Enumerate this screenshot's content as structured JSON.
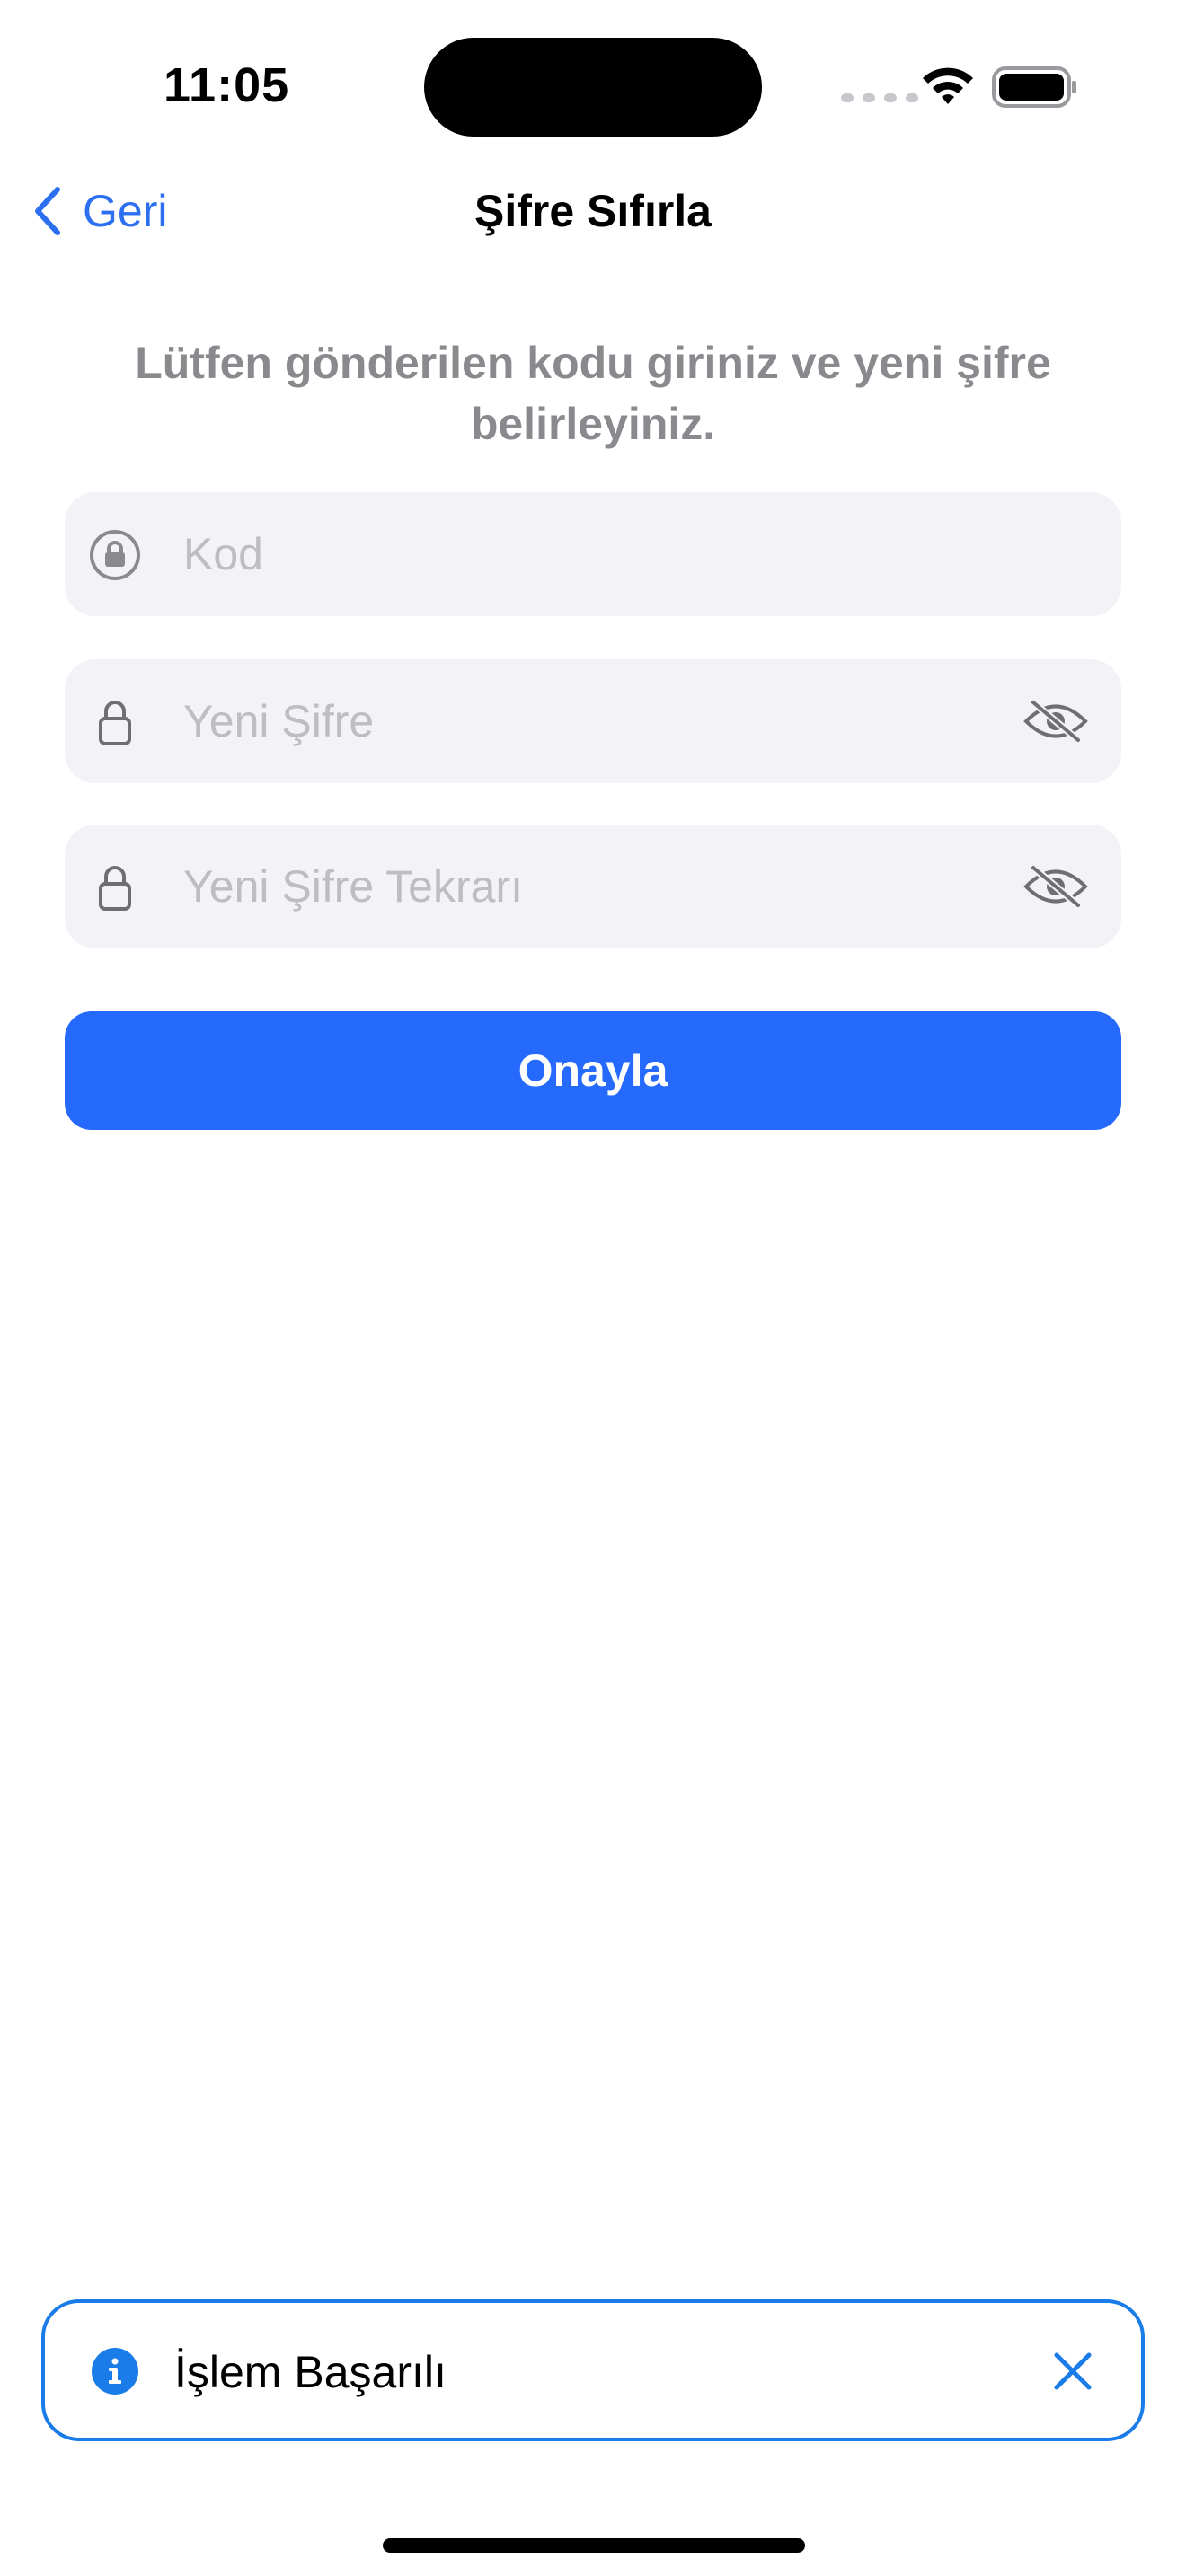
{
  "status_bar": {
    "time": "11:05",
    "icons": [
      "cellular-signal-icon",
      "wifi-icon",
      "battery-icon"
    ]
  },
  "nav": {
    "back_label": "Geri",
    "title": "Şifre Sıfırla"
  },
  "instruction": "Lütfen gönderilen kodu giriniz ve yeni şifre belirleyiniz.",
  "fields": {
    "code": {
      "placeholder": "Kod",
      "value": "",
      "icon": "lock-circle-icon"
    },
    "new_password": {
      "placeholder": "Yeni Şifre",
      "value": "",
      "icon": "lock-icon",
      "toggle_icon": "eye-slash-icon"
    },
    "new_password_repeat": {
      "placeholder": "Yeni Şifre Tekrarı",
      "value": "",
      "icon": "lock-icon",
      "toggle_icon": "eye-slash-icon"
    }
  },
  "confirm_button": {
    "label": "Onayla"
  },
  "toast": {
    "message": "İşlem Başarılı",
    "icon": "info-icon",
    "close_icon": "close-icon"
  },
  "colors": {
    "accent": "#2669fd",
    "back_link": "#2c6ff0",
    "field_background": "#f2f2f7",
    "placeholder": "#bdbdc2",
    "instruction_text": "#8a8a8e",
    "toast_border": "#1a7ce8"
  }
}
